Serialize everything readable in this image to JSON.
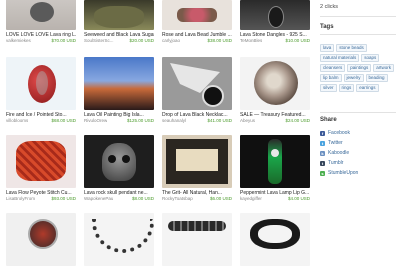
{
  "listings": [
    {
      "title": "LOVE LOVE LOVE Lava ring L...",
      "shop": "valkemiekes",
      "price": "$70.00 USD"
    },
    {
      "title": "Seeweed and Black Lava Sugar...",
      "shop": "SoulSisterSc...",
      "price": "$20.00 USD"
    },
    {
      "title": "Rose and Lava Bead Jumble ...",
      "shop": "carlyjoao",
      "price": "$38.00 USD"
    },
    {
      "title": "Lava Stone Dangles - 925 S...",
      "shop": "TeMonBles",
      "price": "$10.00 USD"
    },
    {
      "title": "Fire and Ice / Pointed Sto...",
      "shop": "villoblooms",
      "price": "$68.00 USD"
    },
    {
      "title": "Lava Oil Painting Big Isla...",
      "shop": "RivuloOrew",
      "price": "$125.00 USD"
    },
    {
      "title": "Drop of Lava Black Necklac...",
      "shop": "seauhanalyl",
      "price": "$41.00 USD"
    },
    {
      "title": "SALE — Treasury Featured...",
      "shop": "Abeyus",
      "price": "$24.00 USD"
    },
    {
      "title": "Lava Flow Peyote Stitch Cu...",
      "shop": "LisaBrolyFrom",
      "price": "$93.00 USD"
    },
    {
      "title": "Lava rock skull pendant ne...",
      "shop": "WapokenePau",
      "price": "$8.00 USD"
    },
    {
      "title": "The Grit- All Natural, Han...",
      "shop": "RockyToatsbap",
      "price": "$6.00 USD"
    },
    {
      "title": "Peppermint Lava Lamp Lip G...",
      "shop": "kayedgiffer",
      "price": "$4.00 USD"
    },
    {
      "title": "",
      "shop": "",
      "price": ""
    },
    {
      "title": "",
      "shop": "",
      "price": ""
    },
    {
      "title": "",
      "shop": "",
      "price": ""
    },
    {
      "title": "",
      "shop": "",
      "price": ""
    }
  ],
  "sidebar": {
    "clicks": "2 clicks",
    "tags_title": "Tags",
    "tags": [
      "lava",
      "stone beads",
      "natural materials",
      "soaps",
      "cleansers",
      "paintings",
      "artwork",
      "lip balm",
      "jewelry",
      "beading",
      "silver",
      "rings",
      "earrings"
    ],
    "share_title": "Share",
    "share_items": [
      {
        "label": "Facebook",
        "icon": "facebook-icon",
        "color": "#3b5998",
        "glyph": "f"
      },
      {
        "label": "Twitter",
        "icon": "twitter-icon",
        "color": "#4aa3df",
        "glyph": "t"
      },
      {
        "label": "Kaboodle",
        "icon": "kaboodle-icon",
        "color": "#6a8fc0",
        "glyph": "k"
      },
      {
        "label": "Tumblr",
        "icon": "tumblr-icon",
        "color": "#35465c",
        "glyph": "t"
      },
      {
        "label": "StumbleUpon",
        "icon": "stumbleupon-icon",
        "color": "#4caf50",
        "glyph": "s"
      }
    ]
  }
}
